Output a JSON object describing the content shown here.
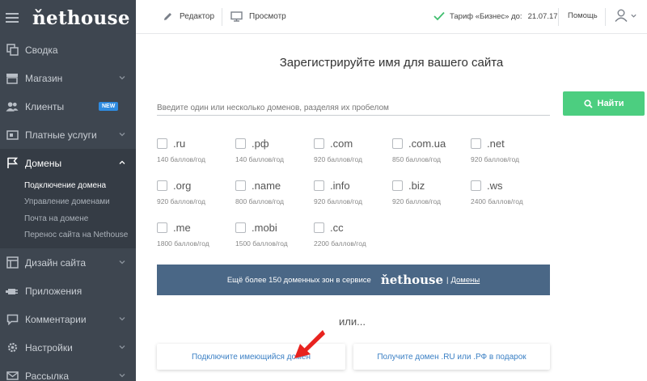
{
  "app": {
    "logo": "ňethouse"
  },
  "sidebar": {
    "items": [
      {
        "label": "Сводка",
        "icon": "copy-icon"
      },
      {
        "label": "Магазин",
        "icon": "store-icon"
      },
      {
        "label": "Клиенты",
        "icon": "users-icon",
        "badge": "NEW"
      },
      {
        "label": "Платные услуги",
        "icon": "wallet-icon"
      },
      {
        "label": "Домены",
        "icon": "flag-icon"
      },
      {
        "label": "Дизайн сайта",
        "icon": "layout-icon"
      },
      {
        "label": "Приложения",
        "icon": "plugin-icon"
      },
      {
        "label": "Комментарии",
        "icon": "comment-icon"
      },
      {
        "label": "Настройки",
        "icon": "gear-icon"
      },
      {
        "label": "Рассылка",
        "icon": "mail-icon"
      }
    ],
    "domains_submenu": [
      "Подключение домена",
      "Управление доменами",
      "Почта на домене",
      "Перенос сайта на Nethouse"
    ]
  },
  "topbar": {
    "editor": "Редактор",
    "preview": "Просмотр",
    "tariff": "Тариф «Бизнес» до:",
    "tariff_date": "21.07.17",
    "help": "Помощь"
  },
  "main": {
    "title": "Зарегистрируйте имя для вашего сайта",
    "input_placeholder": "Введите один или несколько доменов, разделяя их пробелом",
    "find_button": "Найти",
    "zones": [
      {
        "name": ".ru",
        "price": "140 баллов/год"
      },
      {
        "name": ".рф",
        "price": "140 баллов/год"
      },
      {
        "name": ".com",
        "price": "920 баллов/год"
      },
      {
        "name": ".com.ua",
        "price": "850 баллов/год"
      },
      {
        "name": ".net",
        "price": "920 баллов/год"
      },
      {
        "name": ".org",
        "price": "920 баллов/год"
      },
      {
        "name": ".name",
        "price": "800 баллов/год"
      },
      {
        "name": ".info",
        "price": "920 баллов/год"
      },
      {
        "name": ".biz",
        "price": "920 баллов/год"
      },
      {
        "name": ".ws",
        "price": "2400 баллов/год"
      },
      {
        "name": ".me",
        "price": "1800 баллов/год"
      },
      {
        "name": ".mobi",
        "price": "1500 баллов/год"
      },
      {
        "name": ".cc",
        "price": "2200 баллов/год"
      }
    ],
    "promo_text": "Ещё более 150 доменных зон в сервисе",
    "promo_brand": "ňethouse",
    "promo_sep": "|",
    "promo_link": "Домены",
    "or_text": "или...",
    "connect_button": "Подключите имеющийся домен",
    "gift_button": "Получите домен .RU или .РФ в подарок"
  },
  "colors": {
    "sidebar": "#3e4650",
    "accent_green": "#4cce80",
    "promo_bg": "#4a6786",
    "link_blue": "#3a7fc4",
    "annotation_red": "#e8231f"
  }
}
